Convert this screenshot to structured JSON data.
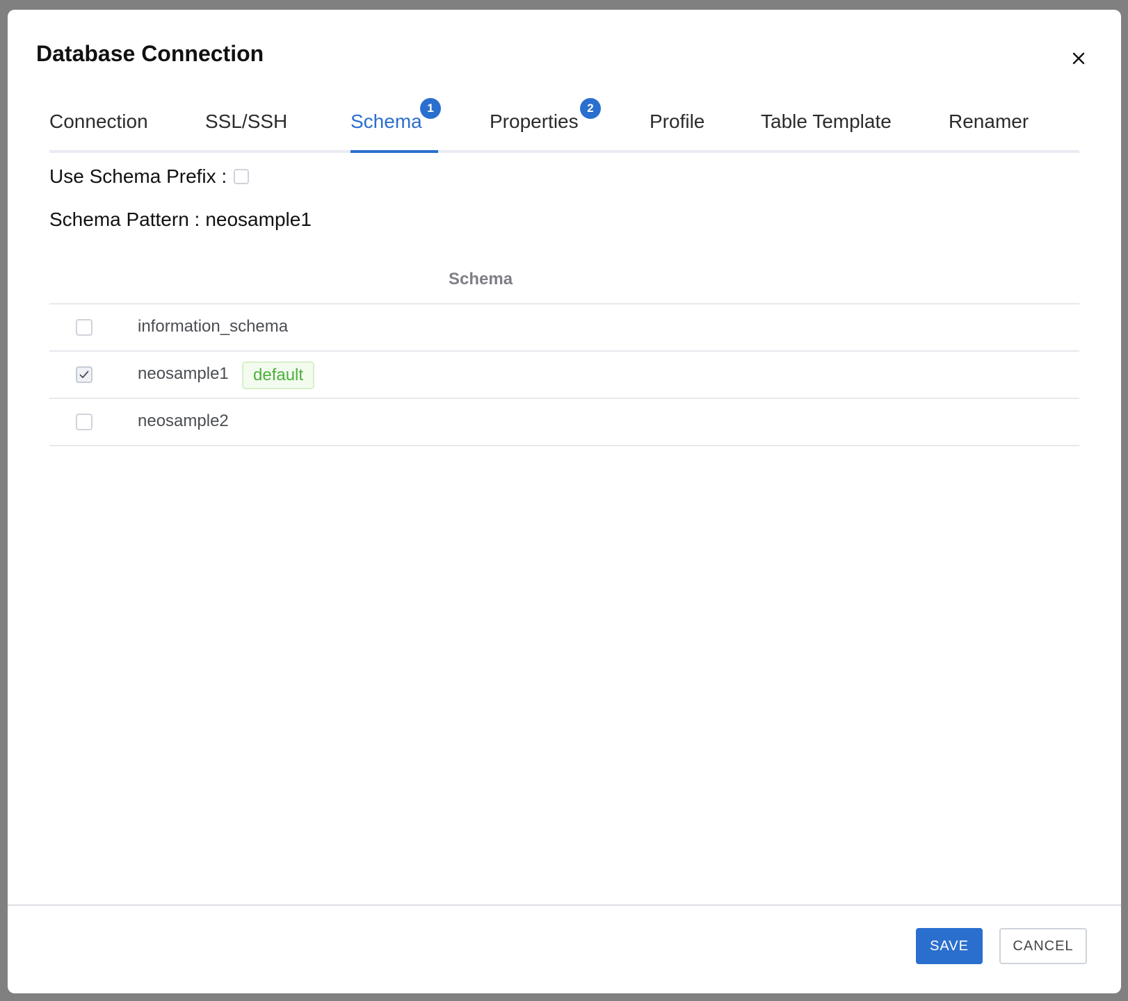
{
  "dialog": {
    "title": "Database Connection"
  },
  "tabs": [
    {
      "label": "Connection",
      "badge": null,
      "active": false
    },
    {
      "label": "SSL/SSH",
      "badge": null,
      "active": false
    },
    {
      "label": "Schema",
      "badge": "1",
      "active": true
    },
    {
      "label": "Properties",
      "badge": "2",
      "active": false
    },
    {
      "label": "Profile",
      "badge": null,
      "active": false
    },
    {
      "label": "Table Template",
      "badge": null,
      "active": false
    },
    {
      "label": "Renamer",
      "badge": null,
      "active": false
    }
  ],
  "schema_tab": {
    "use_prefix_label": "Use Schema Prefix :",
    "use_prefix_checked": false,
    "pattern_label": "Schema Pattern :",
    "pattern_value": "neosample1",
    "table": {
      "column_header": "Schema",
      "rows": [
        {
          "name": "information_schema",
          "checked": false,
          "tag": null
        },
        {
          "name": "neosample1",
          "checked": true,
          "tag": "default"
        },
        {
          "name": "neosample2",
          "checked": false,
          "tag": null
        }
      ]
    }
  },
  "footer": {
    "save_label": "SAVE",
    "cancel_label": "CANCEL"
  },
  "colors": {
    "accent": "#2b6fce",
    "tag_text": "#4caf3a",
    "tag_bg": "#f3fbef",
    "overlay": "#808080"
  },
  "icons": {
    "close": "close-icon",
    "check": "checkmark-icon"
  }
}
